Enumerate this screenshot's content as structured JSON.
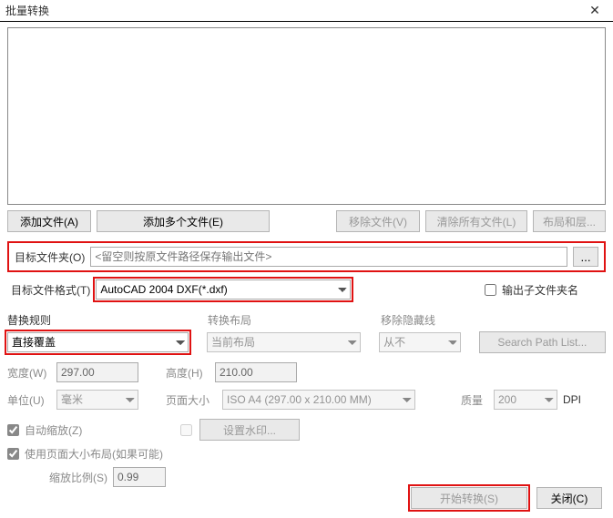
{
  "window": {
    "title": "批量转换",
    "close": "✕"
  },
  "toolbar": {
    "add_file": "添加文件(A)",
    "add_multi": "添加多个文件(E)",
    "remove_file": "移除文件(V)",
    "clear_all": "清除所有文件(L)",
    "layout_layer": "布局和层..."
  },
  "target": {
    "folder_label": "目标文件夹(O)",
    "folder_placeholder": "<留空则按原文件路径保存输出文件>",
    "browse": "...",
    "format_label": "目标文件格式(T)",
    "format_value": "AutoCAD 2004 DXF(*.dxf)",
    "output_subfolder": "输出子文件夹名"
  },
  "rules": {
    "replace_label": "替换规则",
    "replace_value": "直接覆盖",
    "convert_layout_label": "转换布局",
    "convert_layout_value": "当前布局",
    "hide_lines_label": "移除隐藏线",
    "hide_lines_value": "从不",
    "search_path": "Search Path List..."
  },
  "dims": {
    "width_label": "宽度(W)",
    "width_value": "297.00",
    "height_label": "高度(H)",
    "height_value": "210.00",
    "unit_label": "单位(U)",
    "unit_value": "毫米",
    "pagesize_label": "页面大小",
    "pagesize_value": "ISO A4 (297.00 x 210.00 MM)",
    "quality_label": "质量",
    "quality_value": "200",
    "dpi": "DPI"
  },
  "options": {
    "auto_scale": "自动缩放(Z)",
    "set_watermark": "设置水印...",
    "use_page_layout": "使用页面大小布局(如果可能)",
    "scale_ratio_label": "缩放比例(S)",
    "scale_ratio_value": "0.99"
  },
  "footer": {
    "start": "开始转换(S)",
    "close": "关闭(C)"
  }
}
